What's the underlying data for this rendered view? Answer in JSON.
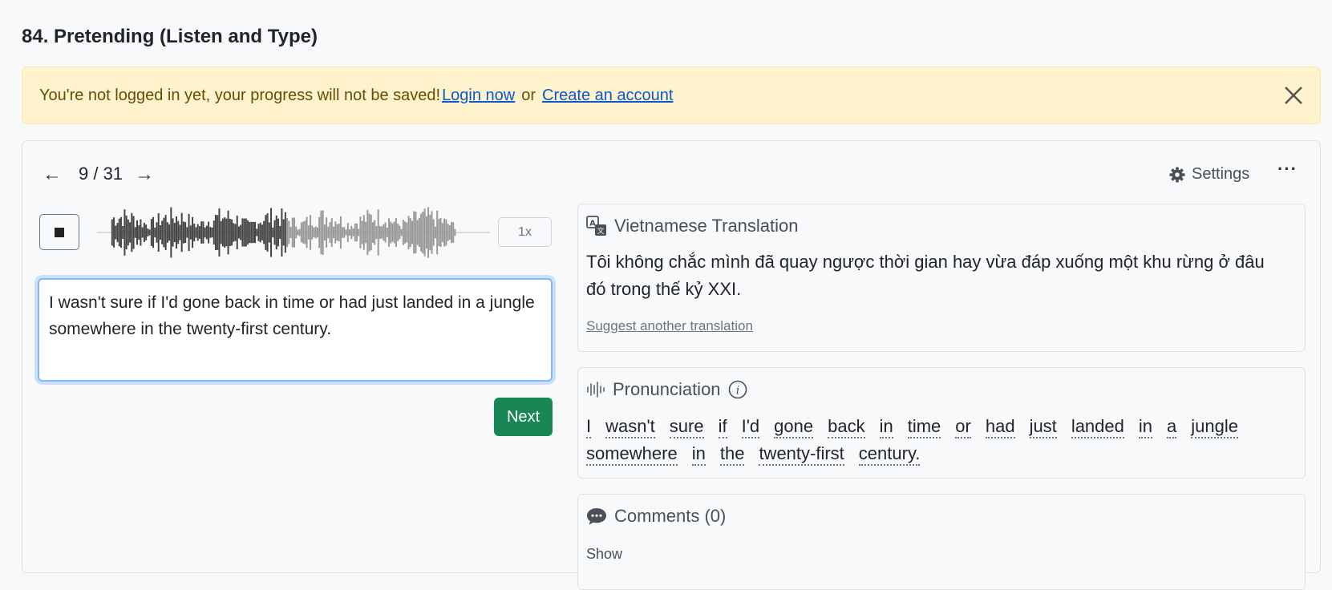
{
  "page": {
    "title": "84. Pretending (Listen and Type)"
  },
  "alert": {
    "message": "You're not logged in yet, your progress will not be saved!",
    "login_link": "Login now",
    "separator": "or",
    "create_link": "Create an account",
    "close_icon": "close-icon"
  },
  "navigation": {
    "prev_icon": "arrow-left-icon",
    "counter": "9 / 31",
    "next_icon": "arrow-right-icon"
  },
  "toolbar": {
    "settings_label": "Settings",
    "settings_icon": "gear-icon",
    "more_icon": "more-icon"
  },
  "player": {
    "stop_icon": "stop-icon",
    "speed": "1x",
    "progress": 0.48,
    "played_color": "#444444",
    "unplayed_color": "#999999"
  },
  "answer": {
    "value": "I wasn't sure if I'd gone back in time or had just landed in a jungle somewhere in the twenty-first century."
  },
  "next_button": {
    "label": "Next",
    "color": "#198754"
  },
  "translation": {
    "icon": "translate-icon",
    "title": "Vietnamese Translation",
    "text": "Tôi không chắc mình đã quay ngược thời gian hay vừa đáp xuống một khu rừng ở đâu đó trong thế kỷ XXI.",
    "suggest_link": "Suggest another translation"
  },
  "pronunciation": {
    "icon": "sound-wave-icon",
    "title": "Pronunciation",
    "info_icon": "info-icon",
    "words": [
      "I",
      "wasn't",
      "sure",
      "if",
      "I'd",
      "gone",
      "back",
      "in",
      "time",
      "or",
      "had",
      "just",
      "landed",
      "in",
      "a",
      "jungle",
      "somewhere",
      "in",
      "the",
      "twenty-first",
      "century."
    ]
  },
  "comments": {
    "icon": "comment-icon",
    "title": "Comments (0)",
    "show_link": "Show"
  }
}
